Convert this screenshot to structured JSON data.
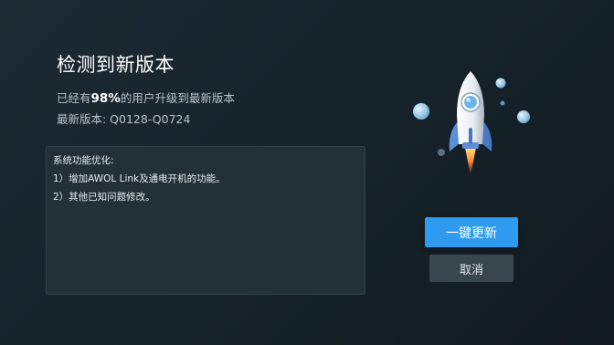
{
  "dialog": {
    "title": "检测到新版本",
    "subtitle_prefix": "已经有",
    "subtitle_percent": "98%",
    "subtitle_suffix": "的用户升级到最新版本",
    "version_label": "最新版本: Q0128-Q0724"
  },
  "release_notes": {
    "lines": [
      "系统功能优化:",
      "1）增加AWOL Link及通电开机的功能。",
      "2）其他已知问题修改。"
    ]
  },
  "illustration": {
    "icon": "rocket-icon",
    "colors": {
      "rocket_body": "#e8edf2",
      "rocket_window": "#6fb4e6",
      "fin": "#5b8fd6",
      "flame": "#ff8a3c",
      "bubbles": "#a9d2ea"
    }
  },
  "buttons": {
    "update_label": "一键更新",
    "cancel_label": "取消"
  },
  "colors": {
    "accent": "#2e9af0",
    "background": "#17232b",
    "panel": "#243038",
    "secondary_button": "#3a464e"
  }
}
